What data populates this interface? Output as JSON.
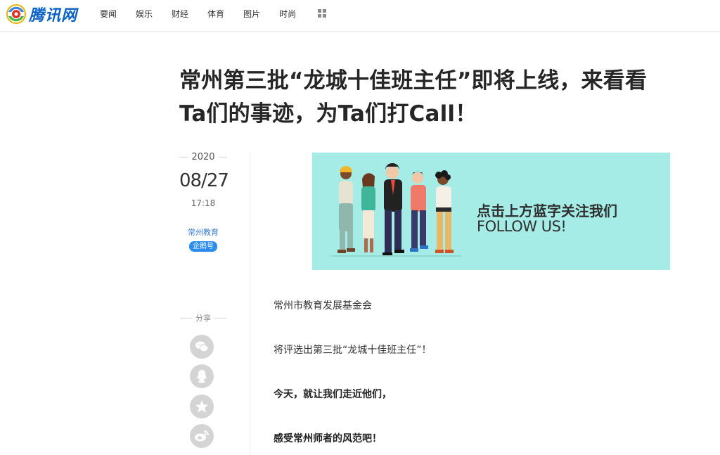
{
  "site": {
    "logo_text": "腾讯网"
  },
  "nav": {
    "items": [
      "要闻",
      "娱乐",
      "财经",
      "体育",
      "图片",
      "时尚"
    ]
  },
  "article": {
    "title_line1": "常州第三批“龙城十佳班主任”即将上线，来看看",
    "title_line2": "Ta们的事迹，为Ta们打Call！",
    "year": "2020",
    "date": "08/27",
    "time": "17:18",
    "source": "常州教育",
    "badge": "企鹅号",
    "banner_cn": "点击上方蓝字关注我们",
    "banner_en": "FOLLOW US!",
    "paragraphs": [
      "常州市教育发展基金会",
      "将评选出第三批“龙城十佳班主任”！",
      "今天，就让我们走近他们，",
      "感受常州师者的风范吧！"
    ]
  },
  "share": {
    "label": "分享"
  }
}
